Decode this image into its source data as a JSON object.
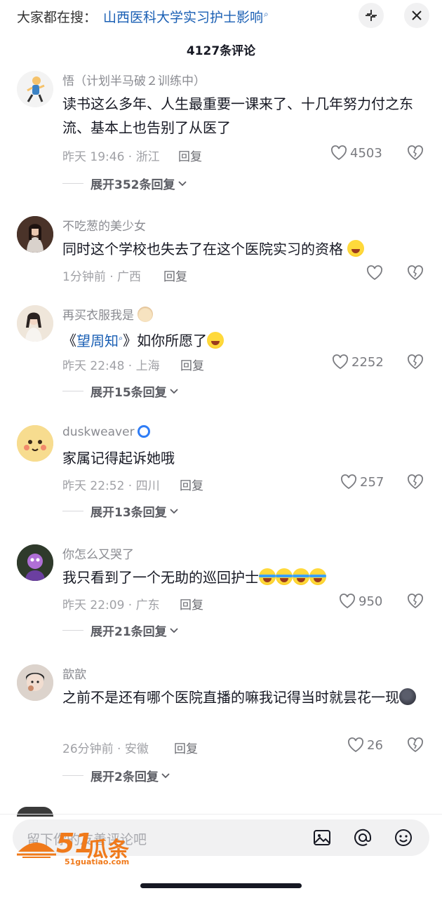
{
  "header": {
    "search_prefix": "大家都在搜：",
    "search_keyword": "山西医科大学实习护士影响",
    "collapse_icon": "collapse-icon",
    "close_icon": "close-icon"
  },
  "comment_count": "4127条评论",
  "comments": [
    {
      "username": "悟（计划半马破２训练中）",
      "text": "读书这么多年、人生最重要一课来了、十几年努力付之东流、基本上也告别了从医了",
      "meta": "昨天 19:46 · 浙江",
      "reply": "回复",
      "likes": "4503",
      "expand": "展开352条回复"
    },
    {
      "username": "不吃葱的美少女",
      "text": "同时这个学校也失去了在这个医院实习的资格",
      "meta": "1分钟前 · 广西",
      "reply": "回复",
      "likes": "",
      "expand": ""
    },
    {
      "username": "再买衣服我是",
      "text_prefix": "《",
      "text_link": "望周知",
      "text_suffix": "》如你所愿了",
      "meta": "昨天 22:48 · 上海",
      "reply": "回复",
      "likes": "2252",
      "expand": "展开15条回复"
    },
    {
      "username": "duskweaver",
      "text": "家属记得起诉她哦",
      "meta": "昨天 22:52 · 四川",
      "reply": "回复",
      "likes": "257",
      "expand": "展开13条回复"
    },
    {
      "username": "你怎么又哭了",
      "text": "我只看到了一个无助的巡回护士",
      "meta": "昨天 22:09 · 广东",
      "reply": "回复",
      "likes": "950",
      "expand": "展开21条回复"
    },
    {
      "username": "歆歆",
      "text": "之前不是还有哪个医院直播的嘛我记得当时就昙花一现",
      "meta": "26分钟前 · 安徽",
      "reply": "回复",
      "likes": "26",
      "expand": "展开2条回复"
    }
  ],
  "input": {
    "placeholder": "留下你的友善评论吧",
    "icons": [
      "image-icon",
      "mention-icon",
      "emoji-icon"
    ]
  },
  "watermark": {
    "brand_number": "51",
    "brand_text": "瓜条",
    "url": "51guatiao.com"
  },
  "colors": {
    "link": "#1a5fb4",
    "text": "#161823",
    "muted": "#a0a1a6",
    "watermark": "#f07a1b"
  }
}
